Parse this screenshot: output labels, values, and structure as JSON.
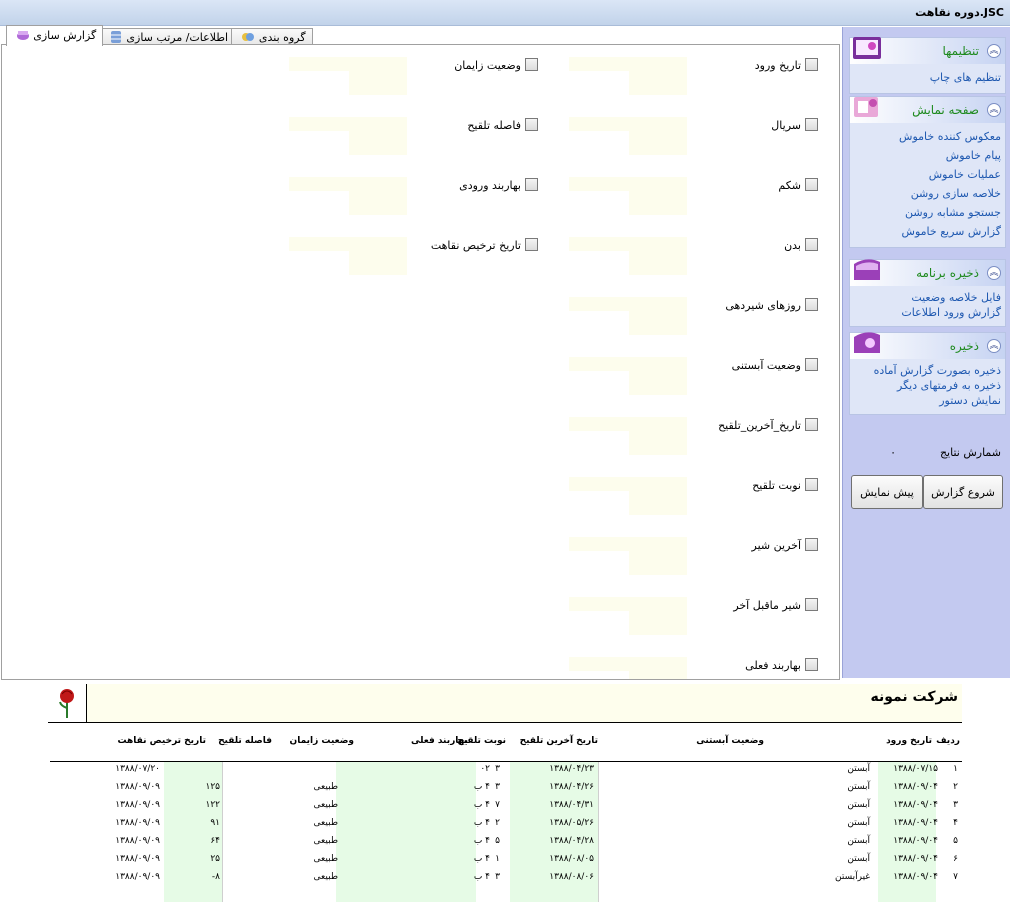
{
  "window": {
    "title": "دوره نقاهت.JSC"
  },
  "tabs": [
    {
      "label": "گزارش سازی",
      "icon": "report-icon",
      "active": true
    },
    {
      "label": "اطلاعات/ مرتب سازی",
      "icon": "database-icon",
      "active": false
    },
    {
      "label": "گروه بندی",
      "icon": "group-icon",
      "active": false
    }
  ],
  "fields_right": [
    {
      "label": "تاریخ ورود"
    },
    {
      "label": "سریال"
    },
    {
      "label": "شکم"
    },
    {
      "label": "بدن"
    },
    {
      "label": "روزهای شیردهی"
    },
    {
      "label": "وضعیت آبستنی"
    },
    {
      "label": "تاریخ_آخرین_تلقیح"
    },
    {
      "label": "نوبت تلقیح"
    },
    {
      "label": "آخرین شیر"
    },
    {
      "label": "شیر ماقبل آخر"
    },
    {
      "label": "بهاربند فعلی"
    }
  ],
  "fields_left": [
    {
      "label": "وضعیت زایمان"
    },
    {
      "label": "فاصله تلقیح"
    },
    {
      "label": "بهاربند ورودی"
    },
    {
      "label": "تاریخ ترخیص نقاهت"
    }
  ],
  "sidebar": {
    "panels": [
      {
        "title": "تنظیمها",
        "links": [
          "تنظیم های چاپ"
        ]
      },
      {
        "title": "صفحه نمایش",
        "links": [
          "معکوس کننده خاموش",
          "پیام خاموش",
          "عملیات خاموش",
          "خلاصه سازی روشن",
          "جستجو مشابه روشن",
          "گزارش سریع خاموش"
        ]
      },
      {
        "title": "ذخیره برنامه",
        "links": [
          "فایل خلاصه وضعیت",
          "گزارش ورود اطلاعات"
        ]
      },
      {
        "title": "ذخیره",
        "links": [
          "ذخیره بصورت گزارش آماده",
          "ذخیره به فرمتهای دیگر",
          "نمایش دستور"
        ]
      }
    ],
    "result_count_label": "شمارش نتایج",
    "result_count_value": "۰",
    "start_button": "شروع گزارش",
    "preview_button": "پیش نمایش"
  },
  "report": {
    "company": "شرکت نمونه",
    "columns": [
      "ردیف",
      "تاریخ ورود",
      "وضعیت آبستنی",
      "تاریخ آخرین تلقیح",
      "نوبت تلقیح",
      "بهاربند فعلی",
      "وضعیت زایمان",
      "فاصله تلقیح",
      "تاریخ ترخیص نقاهت"
    ],
    "rows": [
      {
        "row": "۱",
        "entry": "۱۳۸۸/۰۷/۱۵",
        "preg": "آبستن",
        "last_ins": "۱۳۸۸/۰۴/۲۳",
        "ins_no": "۳",
        "pen": "۰۲",
        "birth": "",
        "gap": "",
        "release": "۱۳۸۸/۰۷/۲۰"
      },
      {
        "row": "۲",
        "entry": "۱۳۸۸/۰۹/۰۴",
        "preg": "آبستن",
        "last_ins": "۱۳۸۸/۰۴/۲۶",
        "ins_no": "۳",
        "pen": "۴ ب",
        "birth": "طبیعی",
        "gap": "۱۲۵",
        "release": "۱۳۸۸/۰۹/۰۹"
      },
      {
        "row": "۳",
        "entry": "۱۳۸۸/۰۹/۰۴",
        "preg": "آبستن",
        "last_ins": "۱۳۸۸/۰۴/۳۱",
        "ins_no": "۷",
        "pen": "۴ ب",
        "birth": "طبیعی",
        "gap": "۱۲۲",
        "release": "۱۳۸۸/۰۹/۰۹"
      },
      {
        "row": "۴",
        "entry": "۱۳۸۸/۰۹/۰۴",
        "preg": "آبستن",
        "last_ins": "۱۳۸۸/۰۵/۲۶",
        "ins_no": "۲",
        "pen": "۴ ب",
        "birth": "طبیعی",
        "gap": "۹۱",
        "release": "۱۳۸۸/۰۹/۰۹"
      },
      {
        "row": "۵",
        "entry": "۱۳۸۸/۰۹/۰۴",
        "preg": "آبستن",
        "last_ins": "۱۳۸۸/۰۴/۲۸",
        "ins_no": "۵",
        "pen": "۴ ب",
        "birth": "طبیعی",
        "gap": "۶۴",
        "release": "۱۳۸۸/۰۹/۰۹"
      },
      {
        "row": "۶",
        "entry": "۱۳۸۸/۰۹/۰۴",
        "preg": "آبستن",
        "last_ins": "۱۳۸۸/۰۸/۰۵",
        "ins_no": "۱",
        "pen": "۴ ب",
        "birth": "طبیعی",
        "gap": "۲۵",
        "release": "۱۳۸۸/۰۹/۰۹"
      },
      {
        "row": "۷",
        "entry": "۱۳۸۸/۰۹/۰۴",
        "preg": "غیرآبستن",
        "last_ins": "۱۳۸۸/۰۸/۰۶",
        "ins_no": "۳",
        "pen": "۴ ب",
        "birth": "طبیعی",
        "gap": "۸-",
        "release": "۱۳۸۸/۰۹/۰۹"
      }
    ]
  },
  "colors": {
    "accent_green": "#1e8a1e",
    "link_blue": "#1e58b0",
    "field_bg": "#fdfded",
    "report_green": "#e6fbe6",
    "sidebar_bg": "#c3c9f0"
  }
}
